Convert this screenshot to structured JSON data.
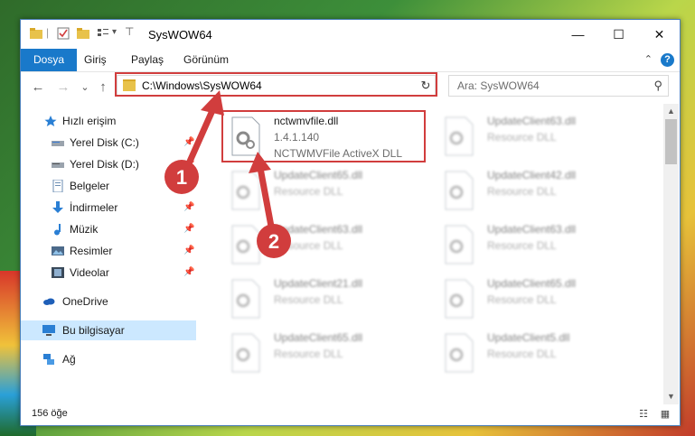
{
  "window": {
    "title": "SysWOW64",
    "controls": {
      "minimize": "—",
      "maximize": "☐",
      "close": "✕"
    }
  },
  "ribbon": {
    "tabs": [
      "Dosya",
      "Giriş",
      "Paylaş",
      "Görünüm"
    ],
    "help": "?",
    "collapse": "⌃"
  },
  "nav": {
    "back": "←",
    "forward": "→",
    "recent": "⌄",
    "up": "↑",
    "address": "C:\\Windows\\SysWOW64",
    "address_dropdown": "⌄",
    "refresh": "↻",
    "search_placeholder": "Ara: SysWOW64",
    "search_glyph": "⚲"
  },
  "sidebar": {
    "items": [
      {
        "label": "Hızlı erişim",
        "icon": "star-icon",
        "pinned": false
      },
      {
        "label": "Yerel Disk (C:)",
        "icon": "drive-icon",
        "pinned": true
      },
      {
        "label": "Yerel Disk (D:)",
        "icon": "drive-icon",
        "pinned": true
      },
      {
        "label": "Belgeler",
        "icon": "document-icon",
        "pinned": true
      },
      {
        "label": "İndirmeler",
        "icon": "download-icon",
        "pinned": true
      },
      {
        "label": "Müzik",
        "icon": "music-icon",
        "pinned": true
      },
      {
        "label": "Resimler",
        "icon": "pictures-icon",
        "pinned": true
      },
      {
        "label": "Videolar",
        "icon": "video-icon",
        "pinned": true
      },
      {
        "label": "OneDrive",
        "icon": "cloud-icon",
        "pinned": false
      },
      {
        "label": "Bu bilgisayar",
        "icon": "computer-icon",
        "pinned": false
      },
      {
        "label": "Ağ",
        "icon": "network-icon",
        "pinned": false
      }
    ],
    "pin_glyph": "📌"
  },
  "files": {
    "highlighted": {
      "name": "nctwmvfile.dll",
      "version": "1.4.1.140",
      "description": "NCTWMVFile ActiveX DLL"
    },
    "others": [
      {
        "name": "UpdateClient63.dll",
        "description": "Resource DLL"
      },
      {
        "name": "UpdateClient65.dll",
        "description": "Resource DLL"
      },
      {
        "name": "UpdateClient42.dll",
        "description": "Resource DLL"
      },
      {
        "name": "UpdateClient63.dll",
        "description": "Resource DLL"
      },
      {
        "name": "UpdateClient63.dll",
        "description": "Resource DLL"
      },
      {
        "name": "UpdateClient21.dll",
        "description": "Resource DLL"
      },
      {
        "name": "UpdateClient65.dll",
        "description": "Resource DLL"
      },
      {
        "name": "UpdateClient65.dll",
        "description": "Resource DLL"
      },
      {
        "name": "UpdateClient5.dll",
        "description": "Resource DLL"
      }
    ]
  },
  "status": {
    "count": "156 öğe"
  },
  "annotations": {
    "step1": "1",
    "step2": "2",
    "color": "#d13d3d"
  },
  "colors": {
    "accent": "#1979ca",
    "selection": "#cce8ff"
  }
}
